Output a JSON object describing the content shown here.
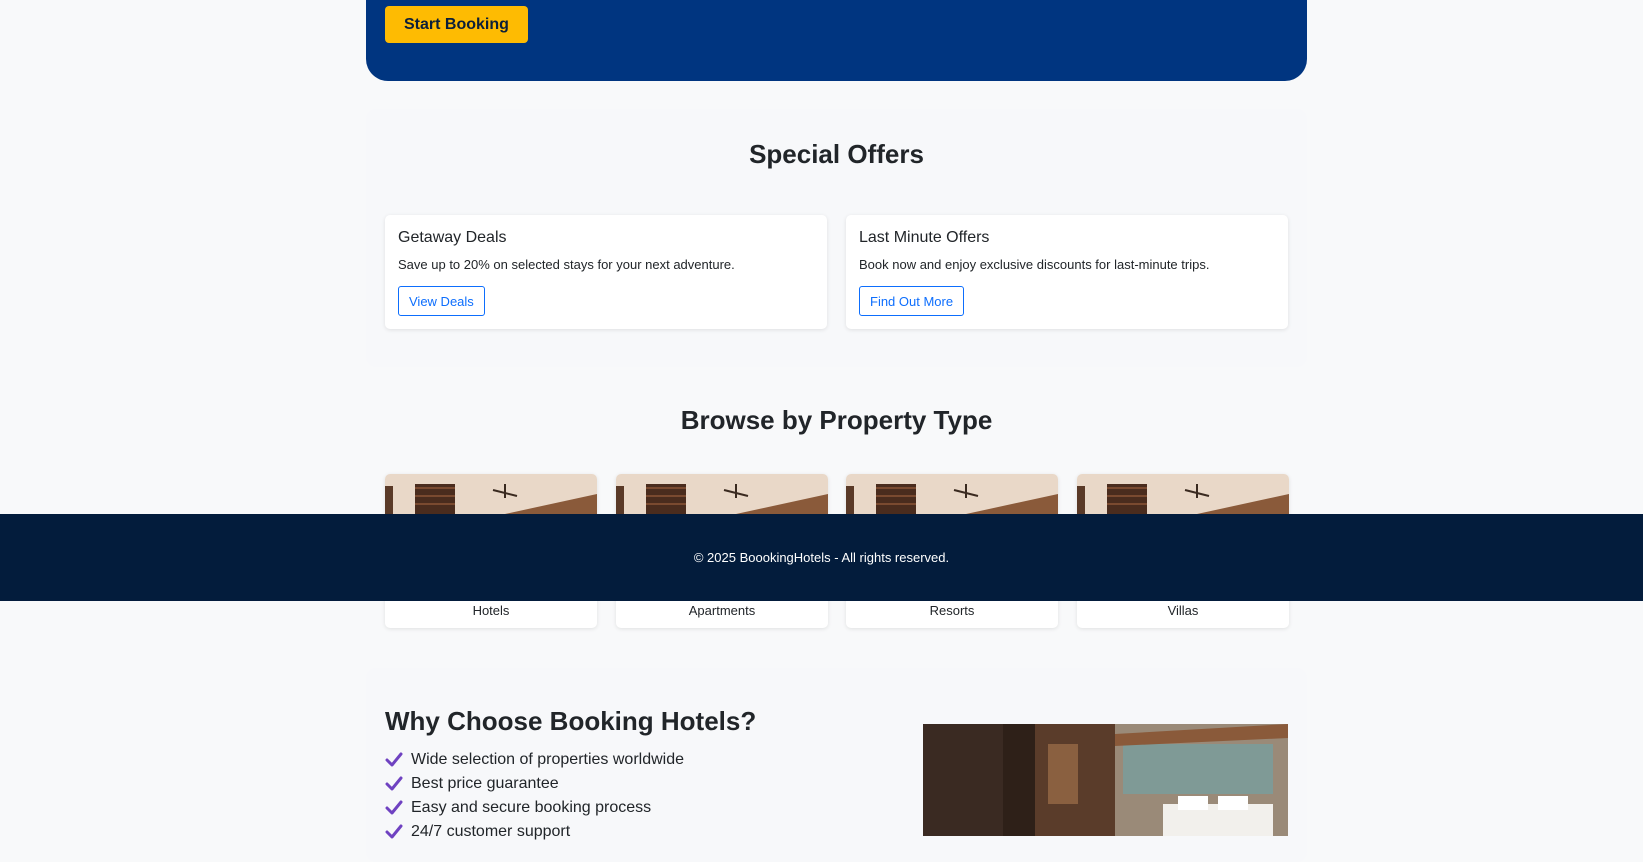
{
  "hero": {
    "start_booking_label": "Start Booking"
  },
  "offers": {
    "title": "Special Offers",
    "cards": [
      {
        "title": "Getaway Deals",
        "desc": "Save up to 20% on selected stays for your next adventure.",
        "button": "View Deals"
      },
      {
        "title": "Last Minute Offers",
        "desc": "Book now and enjoy exclusive discounts for last-minute trips.",
        "button": "Find Out More"
      }
    ]
  },
  "property_types": {
    "title": "Browse by Property Type",
    "items": [
      {
        "label": "Hotels"
      },
      {
        "label": "Apartments"
      },
      {
        "label": "Resorts"
      },
      {
        "label": "Villas"
      }
    ]
  },
  "footer": {
    "text": "© 2025 BoookingHotels - All rights reserved."
  },
  "why": {
    "title": "Why Choose Booking Hotels?",
    "items": [
      "Wide selection of properties worldwide",
      "Best price guarantee",
      "Easy and secure booking process",
      "24/7 customer support"
    ]
  },
  "colors": {
    "hero_bg": "#003580",
    "accent_yellow": "#febb02",
    "link_blue": "#0d6efd",
    "footer_bg": "#031c3c",
    "check_purple": "#6f42c1"
  }
}
